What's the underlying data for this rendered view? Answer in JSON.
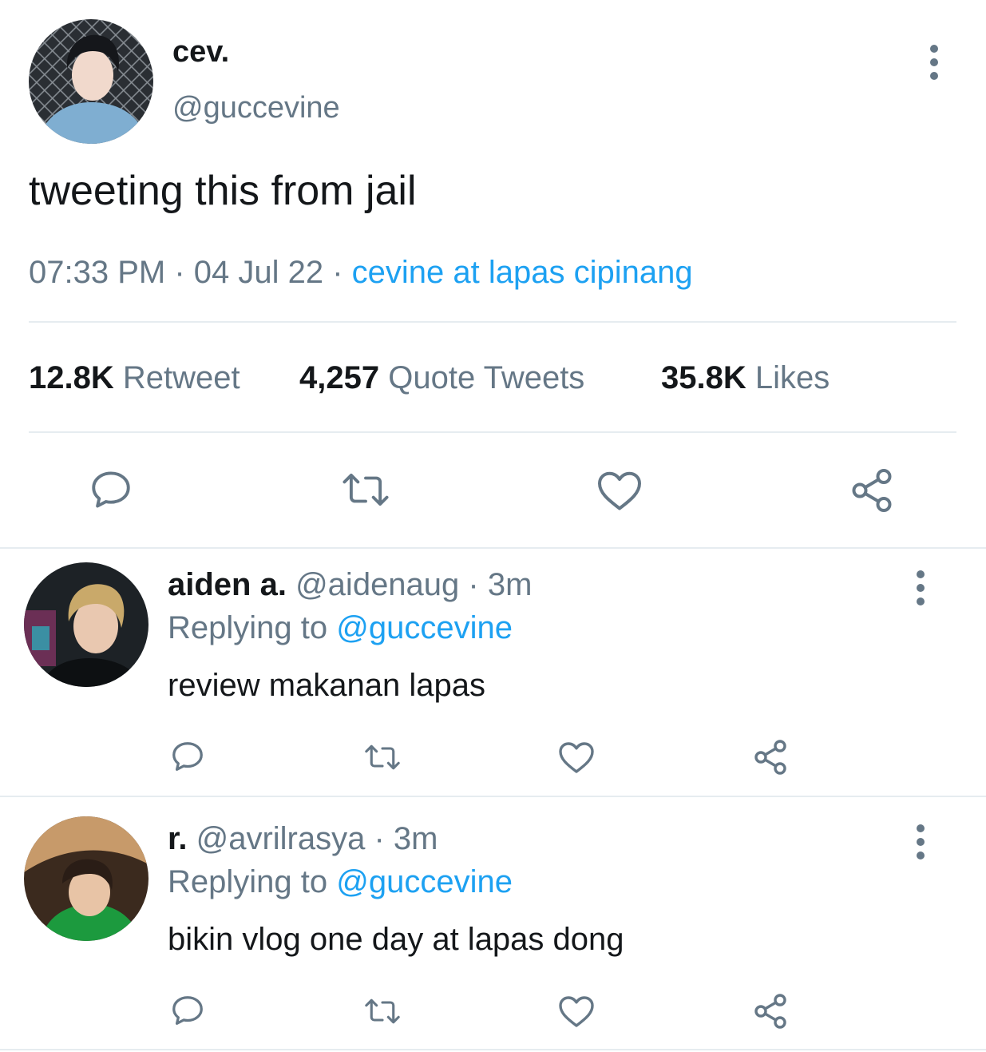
{
  "tweet": {
    "display_name": "cev.",
    "handle": "@guccevine",
    "text": "tweeting this from jail",
    "time": "07:33 PM",
    "date": "04 Jul 22",
    "sep1": " · ",
    "sep2": " · ",
    "source": "cevine at lapas cipinang",
    "stats": {
      "retweets_count": "12.8K",
      "retweets_label": "Retweet",
      "quotes_count": "4,257",
      "quotes_label": "Quote Tweets",
      "likes_count": "35.8K",
      "likes_label": "Likes"
    },
    "actions": [
      "reply-icon",
      "retweet-icon",
      "like-icon",
      "share-icon"
    ],
    "more_icon": "more-vertical-icon"
  },
  "replies": [
    {
      "display_name": "aiden a.",
      "handle": "@aidenaug",
      "time_sep": " · ",
      "time": "3m",
      "replying_label": "Replying to ",
      "replying_to": "@guccevine",
      "text": "review makanan lapas"
    },
    {
      "display_name": "r.",
      "handle": "@avrilrasya",
      "time_sep": " · ",
      "time": "3m",
      "replying_label": "Replying to ",
      "replying_to": "@guccevine",
      "text": "bikin vlog one day at lapas dong"
    }
  ],
  "colors": {
    "accent": "#1da1f2",
    "text": "#14171a",
    "muted": "#657786",
    "divider": "#e6ecf0"
  }
}
